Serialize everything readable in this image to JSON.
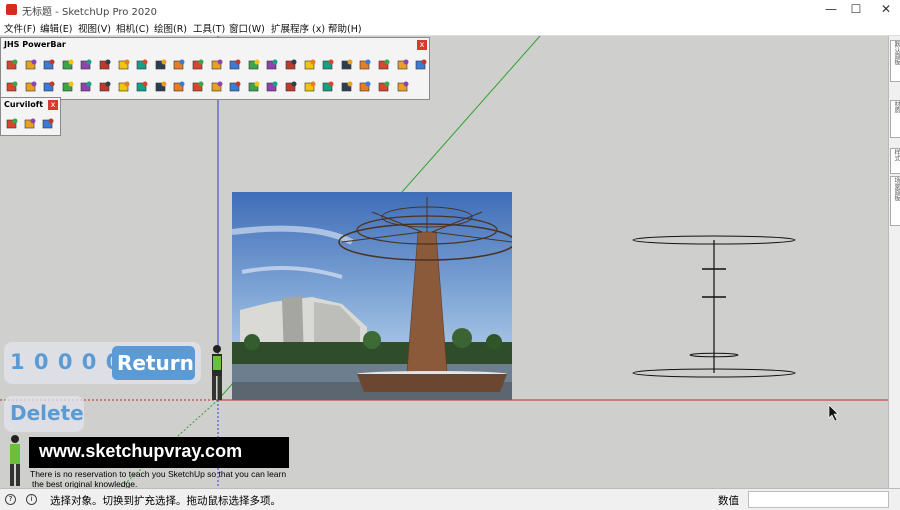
{
  "window": {
    "title": "无标题 - SketchUp Pro 2020",
    "controls": {
      "minimize": "—",
      "maximize": "☐",
      "close": "✕"
    }
  },
  "menubar": [
    "文件(F)",
    "编辑(E)",
    "视图(V)",
    "相机(C)",
    "绘图(R)",
    "工具(T)",
    "窗口(W)",
    "扩展程序 (x)",
    "帮助(H)"
  ],
  "jhs_panel": {
    "title": "JHS PowerBar",
    "close": "x",
    "row1_icons": [
      "push-pull-icon",
      "extrude-icon",
      "layer-icon",
      "surface-icon",
      "slab-icon",
      "eraser-icon",
      "roll-icon",
      "paint-bucket-icon",
      "twist-icon",
      "red-box-icon",
      "section-icon",
      "flag-icon",
      "tree-icon",
      "knife-icon",
      "curve-icon",
      "dots-curve-icon",
      "dots-line-icon",
      "red-cross-icon",
      "green-cross-icon",
      "blue-x-icon",
      "grid-icon",
      "cone-icon",
      "tree-green-icon"
    ],
    "row2_icons": [
      "warning-icon",
      "hook-icon",
      "undo-arrow-icon",
      "rotate-icon",
      "star-move-icon",
      "cup-icon",
      "magnet-icon",
      "green-arrow-icon",
      "stairs-icon",
      "red-ring-icon",
      "blue-box-icon",
      "flower-icon",
      "building-icon",
      "building2-icon",
      "building3-icon",
      "building4-icon",
      "orange-tile-icon",
      "orange-tile2-icon",
      "orange-tile3-icon",
      "red-x-dots-icon",
      "dots-arc-icon",
      "grid-dots-icon"
    ]
  },
  "curviloft_panel": {
    "title": "Curviloft",
    "close": "x",
    "icons": [
      "loft-skin-icon",
      "loft-path-icon",
      "loft-contour-icon"
    ]
  },
  "overlay": {
    "number": "1 0 0 0 0",
    "return_label": "Return",
    "delete_label": "Delete",
    "website": "www.sketchupvray.com",
    "caption_line1": "There is no reservation to teach you SketchUp so that you can learn",
    "caption_line2": "the best original knowledge."
  },
  "tray_tabs": [
    "默认面板",
    "材质",
    "样式",
    "场景面板"
  ],
  "statusbar": {
    "message": "选择对象。切换到扩充选择。拖动鼠标选择多项。",
    "measurements_label": "数值",
    "measurements_value": ""
  },
  "colors": {
    "viewport": "#cfcfcd",
    "overlay_button": "#5b9bd5",
    "red_axis": "#c0292b",
    "green_axis": "#2fa22f",
    "blue_axis": "#3a3ad0"
  }
}
